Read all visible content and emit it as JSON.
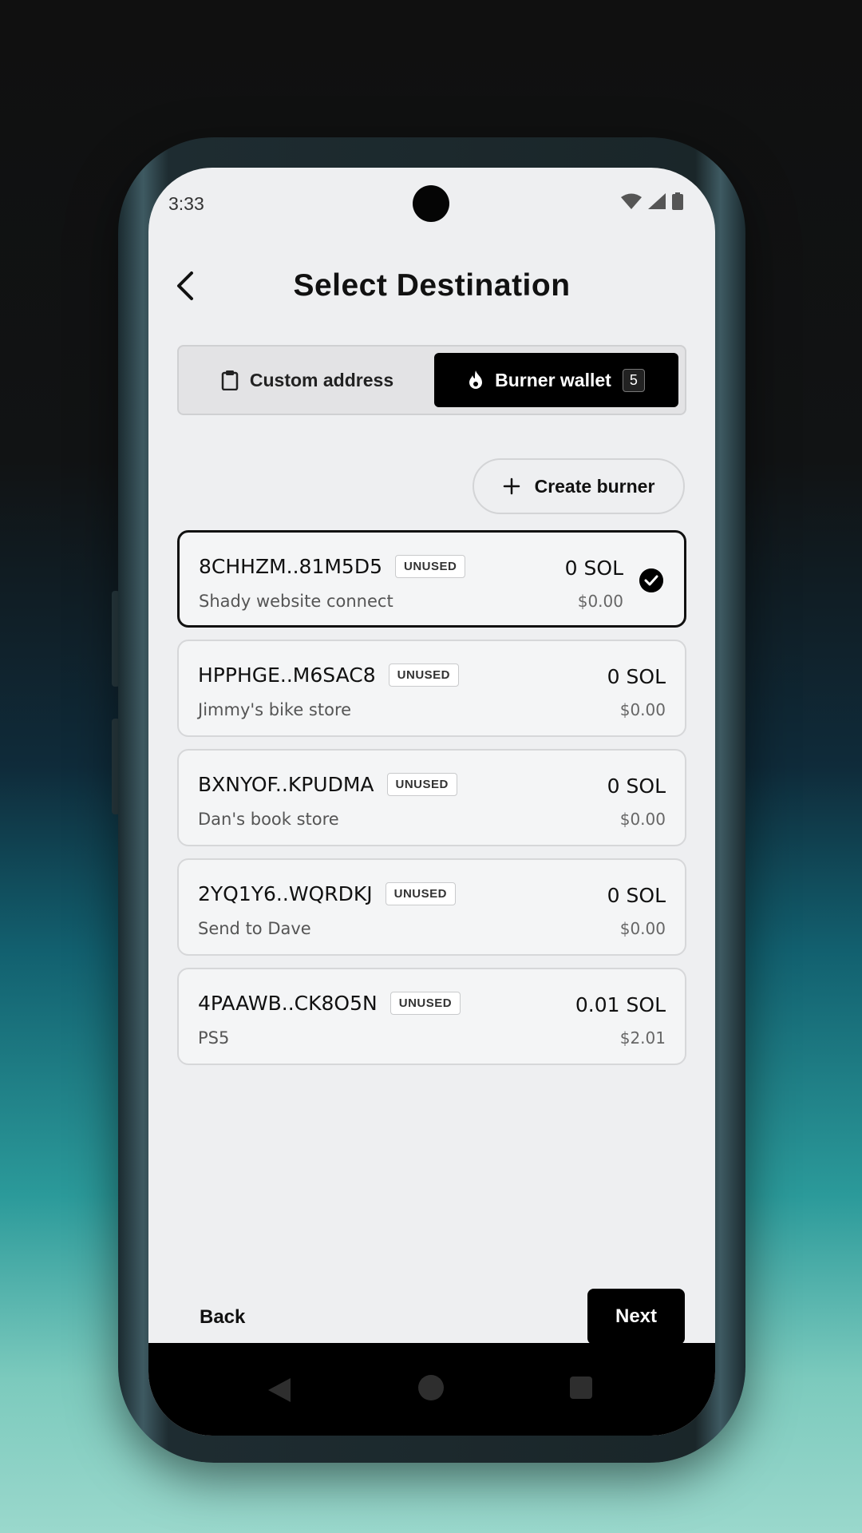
{
  "status_bar": {
    "time": "3:33"
  },
  "header": {
    "title": "Select Destination"
  },
  "segment": {
    "custom_label": "Custom address",
    "burner_label": "Burner wallet",
    "burner_count": "5"
  },
  "create_button": {
    "label": "Create burner"
  },
  "wallets": [
    {
      "address": "8CHHZM..81M5D5",
      "badge": "UNUSED",
      "name": "Shady website connect",
      "sol": "0 SOL",
      "usd": "$0.00",
      "selected": true
    },
    {
      "address": "HPPHGE..M6SAC8",
      "badge": "UNUSED",
      "name": "Jimmy's bike store",
      "sol": "0 SOL",
      "usd": "$0.00",
      "selected": false
    },
    {
      "address": "BXNYOF..KPUDMA",
      "badge": "UNUSED",
      "name": "Dan's book store",
      "sol": "0 SOL",
      "usd": "$0.00",
      "selected": false
    },
    {
      "address": "2YQ1Y6..WQRDKJ",
      "badge": "UNUSED",
      "name": "Send to Dave",
      "sol": "0 SOL",
      "usd": "$0.00",
      "selected": false
    },
    {
      "address": "4PAAWB..CK8O5N",
      "badge": "UNUSED",
      "name": "PS5",
      "sol": "0.01 SOL",
      "usd": "$2.01",
      "selected": false
    }
  ],
  "footer": {
    "back_label": "Back",
    "next_label": "Next"
  },
  "colors": {
    "accent": "#000000",
    "screen_bg": "#eeeff1"
  },
  "icons": [
    "back-arrow-icon",
    "clipboard-icon",
    "flame-icon",
    "plus-icon",
    "check-circle-icon",
    "wifi-icon",
    "signal-icon",
    "battery-icon"
  ]
}
